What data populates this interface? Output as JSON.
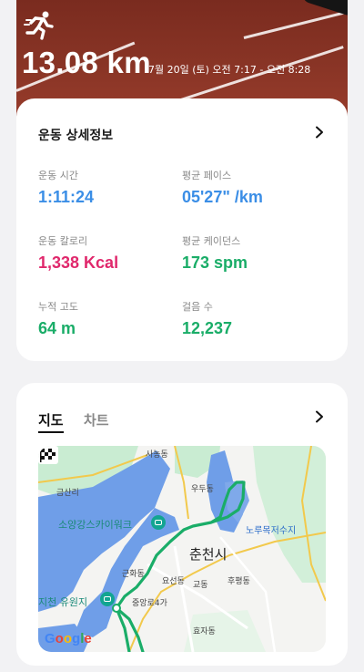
{
  "header": {
    "distance": "13.08 km",
    "date_range": "7월 20일 (토) 오전 7:17 - 오전 8:28",
    "icon": "running-person-icon"
  },
  "detail": {
    "title": "운동 상세정보",
    "stats": [
      {
        "label": "운동 시간",
        "value": "1:11:24",
        "color": "#3b8ee6"
      },
      {
        "label": "평균 페이스",
        "value": "05'27\" /km",
        "color": "#3b8ee6"
      },
      {
        "label": "운동 칼로리",
        "value": "1,338 Kcal",
        "color": "#e0286c"
      },
      {
        "label": "평균 케이던스",
        "value": "173 spm",
        "color": "#1aad68"
      },
      {
        "label": "누적 고도",
        "value": "64 m",
        "color": "#1aad68"
      },
      {
        "label": "걸음 수",
        "value": "12,237",
        "color": "#1aad68"
      }
    ]
  },
  "map_card": {
    "tabs": [
      "지도",
      "차트"
    ],
    "labels": {
      "sanongdong": "사농동",
      "geumsanri": "금산리",
      "ududong": "우두동",
      "soyang_skywalk": "소양강스카이워크",
      "noru": "노루목저수지",
      "chuncheon": "춘천시",
      "geunhwadong": "근화동",
      "yosundong": "요선동",
      "gyodong": "교동",
      "hupyeongdong": "후평동",
      "jicheon": "지천 유원지",
      "jungangro": "중앙로4가",
      "hyojadong": "효자동"
    },
    "google": "Google"
  },
  "colors": {
    "route": "#1aad68",
    "water": "#6f9ee8",
    "park": "#c9ecd2"
  }
}
